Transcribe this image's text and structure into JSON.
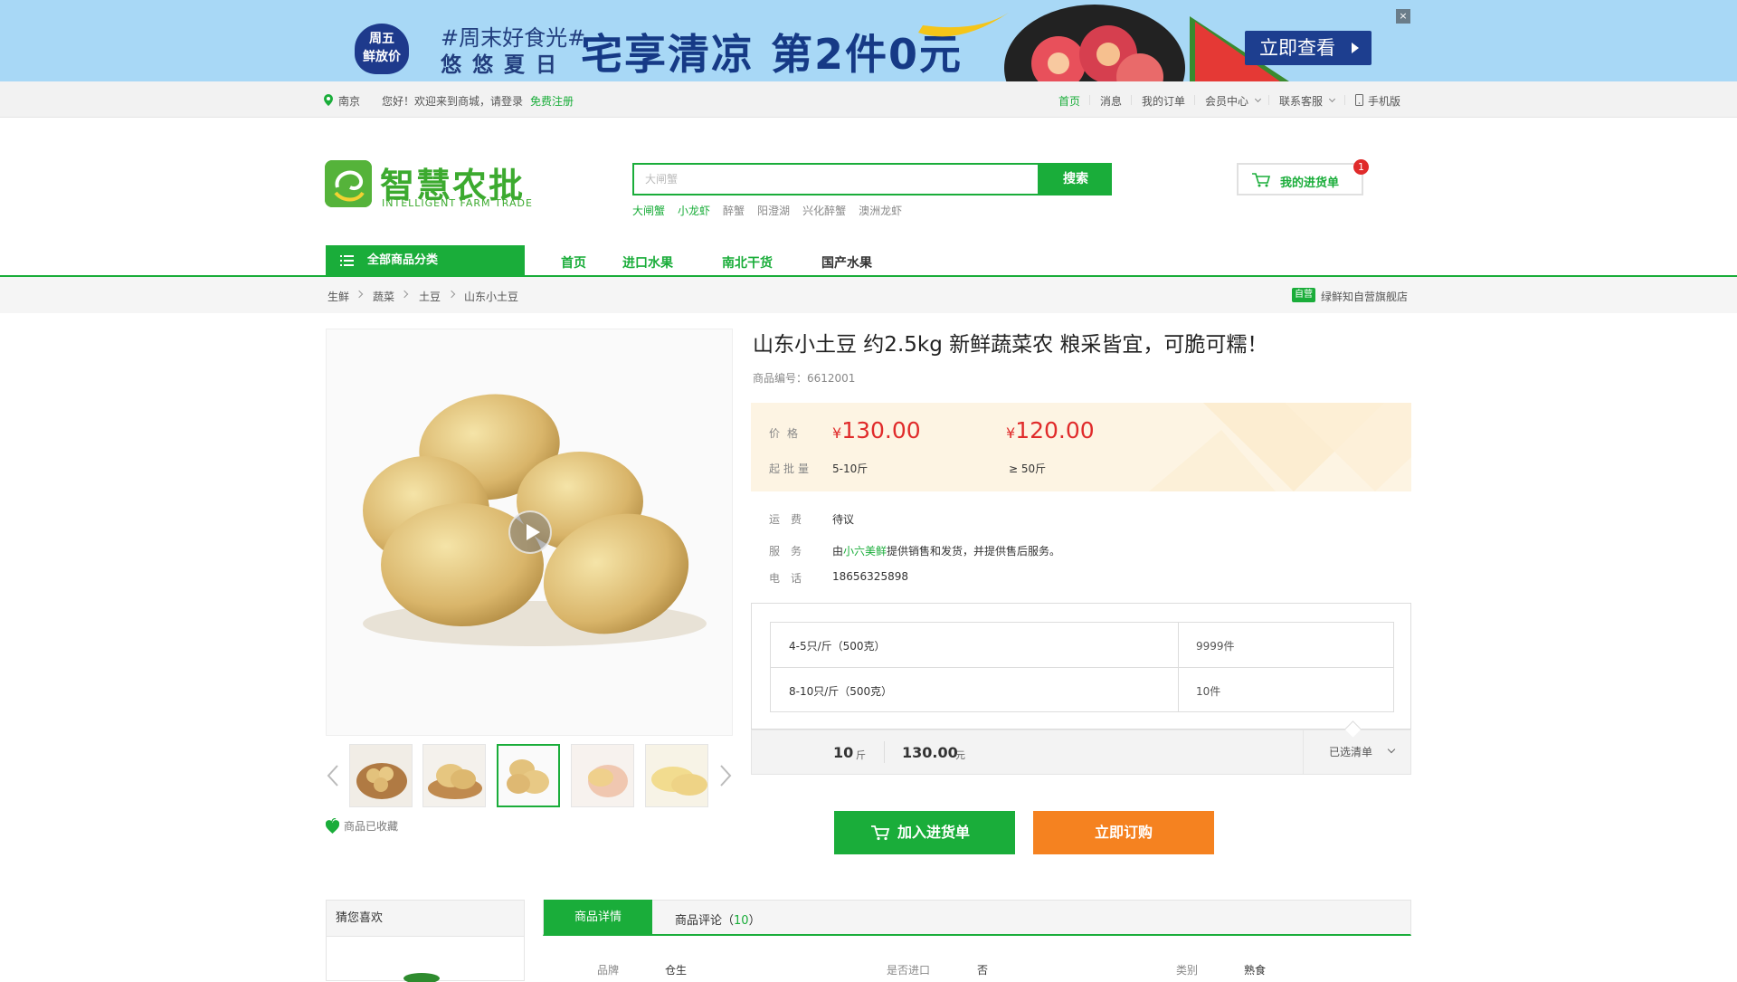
{
  "banner": {
    "badge": "周五\n鲜放价",
    "tagline": "#周末好食光#",
    "subline": "悠悠夏日",
    "headline": "宅享清凉 第2件0元",
    "cta": "立即查看",
    "close": "×"
  },
  "topbar": {
    "location": "南京",
    "welcome": "您好！欢迎来到商城，请登录",
    "register": "免费注册",
    "links": [
      "首页",
      "消息",
      "我的订单",
      "会员中心",
      "联系客服",
      "手机版"
    ]
  },
  "header": {
    "logo_text": "智慧农批",
    "logo_sub": "INTELLIGENT FARM TRADE",
    "search_placeholder": "大闸蟹",
    "search_button": "搜索",
    "hot_keywords": [
      "大闸蟹",
      "小龙虾",
      "醉蟹",
      "阳澄湖",
      "兴化醉蟹",
      "澳洲龙虾"
    ],
    "cart_label": "我的进货单",
    "cart_count": "1"
  },
  "nav": {
    "category_button": "全部商品分类",
    "items": [
      "首页",
      "进口水果",
      "南北干货",
      "国产水果"
    ]
  },
  "breadcrumb": {
    "items": [
      "生鲜",
      "蔬菜",
      "土豆",
      "山东小土豆"
    ],
    "store_tag": "自营",
    "store_name": "绿鲜知自营旗舰店"
  },
  "product": {
    "title": "山东小土豆 约2.5kg 新鲜蔬菜农 粮采皆宜，可脆可糯！",
    "code": "商品编号：6612001",
    "price_label": "价格",
    "moq_label": "起批量",
    "currency": "¥",
    "tier1_price": "130.00",
    "tier1_qty": "5-10斤",
    "tier2_price": "120.00",
    "tier2_qty": "≥ 50斤",
    "shipping_label": "运费",
    "shipping_value": "待议",
    "service_label": "服务",
    "service_prefix": "由",
    "service_vendor": "小六美鲜",
    "service_suffix": "提供销售和发货，并提供售后服务。",
    "phone_label": "电话",
    "phone_value": "18656325898",
    "favorite_text": "商品已收藏"
  },
  "specs": [
    {
      "name": "4-5只/斤（500克）",
      "stock": "9999件"
    },
    {
      "name": "8-10只/斤（500克）",
      "stock": "10件"
    }
  ],
  "summary": {
    "qty": "10",
    "qty_unit": "斤",
    "amount": "130.00",
    "amount_unit": "元",
    "listed_label": "已选清单"
  },
  "actions": {
    "add_cart": "加入进货单",
    "buy_now": "立即订购"
  },
  "bottom": {
    "guess_title": "猜您喜欢",
    "tab_detail": "商品详情",
    "tab_review": "商品评论（",
    "review_count": "10",
    "tab_review_end": "）",
    "attributes": [
      {
        "key": "品牌",
        "value": "仓生"
      },
      {
        "key": "是否进口",
        "value": "否"
      },
      {
        "key": "类别",
        "value": "熟食"
      }
    ]
  },
  "colors": {
    "brand": "#1aad3a",
    "price": "#e02b2b",
    "buy": "#f58220"
  }
}
